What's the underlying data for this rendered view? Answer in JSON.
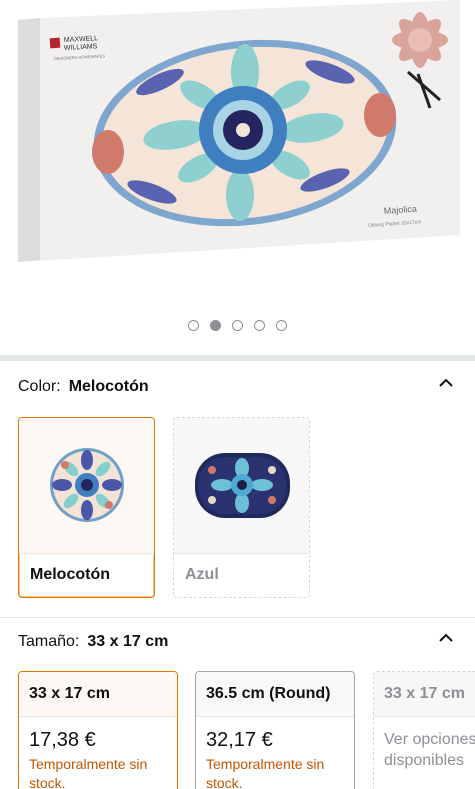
{
  "carousel": {
    "brand_line1": "MAXWELL",
    "brand_line2": "WILLIAMS",
    "brand_sub": "DESIGNERS HOMEWARES",
    "box_title": "Majolica",
    "box_sub": "Oblong Platter 33x17cm",
    "dots": 5,
    "active_dot_index": 1
  },
  "color_section": {
    "label": "Color:",
    "selected": "Melocotón",
    "options": [
      {
        "name": "Melocotón",
        "selected": true
      },
      {
        "name": "Azul",
        "selected": false
      }
    ]
  },
  "size_section": {
    "label": "Tamaño:",
    "selected": "33 x 17 cm",
    "options": [
      {
        "name": "33 x 17 cm",
        "price": "17,38 €",
        "status": "Temporalmente sin stock."
      },
      {
        "name": "36.5 cm (Round)",
        "price": "32,17 €",
        "status": "Temporalmente sin stock."
      },
      {
        "name": "33 x 17 cm",
        "note": "Ver opciones disponibles"
      }
    ]
  },
  "colors": {
    "selected_border": "#e77600",
    "stock_text": "#c45500",
    "muted": "#8d9096"
  }
}
